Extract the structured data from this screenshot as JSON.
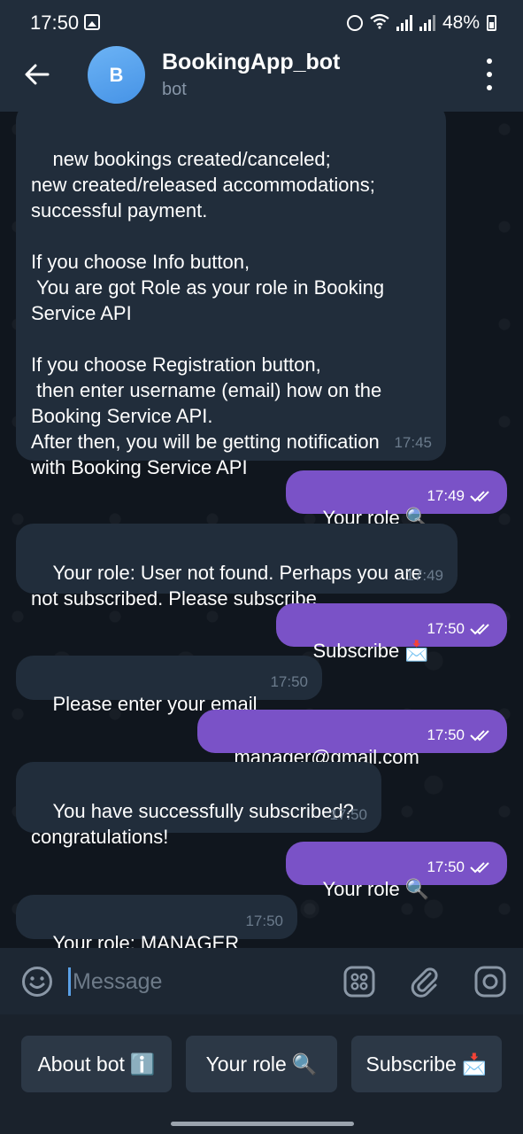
{
  "status_bar": {
    "time": "17:50",
    "battery": "48%"
  },
  "header": {
    "avatar_letter": "B",
    "title": "BookingApp_bot",
    "subtitle": "bot"
  },
  "messages": [
    {
      "direction": "in",
      "text": "new bookings created/canceled;\nnew created/released accommodations;\nsuccessful payment.\n\nIf you choose Info button,\n You are got Role as your role in Booking\nService API\n\nIf you choose Registration button,\n then enter username (email) how on the\nBooking Service API.\nAfter then, you will be getting notification\nwith Booking Service API",
      "time": "17:45"
    },
    {
      "direction": "out",
      "text": "Your role 🔍",
      "time": "17:49"
    },
    {
      "direction": "in",
      "text": "Your role: User not found. Perhaps you are\nnot subscribed. Please subscribe",
      "time": "17:49"
    },
    {
      "direction": "out",
      "text": "Subscribe 📩",
      "time": "17:50"
    },
    {
      "direction": "in",
      "text": "Please enter your email",
      "time": "17:50"
    },
    {
      "direction": "out",
      "text": "manager@gmail.com",
      "time": "17:50"
    },
    {
      "direction": "in",
      "text": "You have successfully subscribed?\ncongratulations!",
      "time": "17:50"
    },
    {
      "direction": "out",
      "text": "Your role 🔍",
      "time": "17:50"
    },
    {
      "direction": "in",
      "text": "Your role: MANAGER",
      "time": "17:50"
    }
  ],
  "composer": {
    "placeholder": "Message",
    "icons": [
      "emoji-icon",
      "keyboard-grid-icon",
      "paperclip-icon",
      "camera-icon"
    ]
  },
  "keyboard_buttons": [
    {
      "label": "About bot",
      "icon": "ℹ️"
    },
    {
      "label": "Your role",
      "icon": "🔍"
    },
    {
      "label": "Subscribe",
      "icon": "📩"
    }
  ],
  "colors": {
    "header_bg": "#212d3b",
    "chat_bg": "#10161e",
    "incoming_bubble": "#212d3b",
    "outgoing_bubble": "#7a52c7",
    "accent": "#5aa0e6"
  }
}
